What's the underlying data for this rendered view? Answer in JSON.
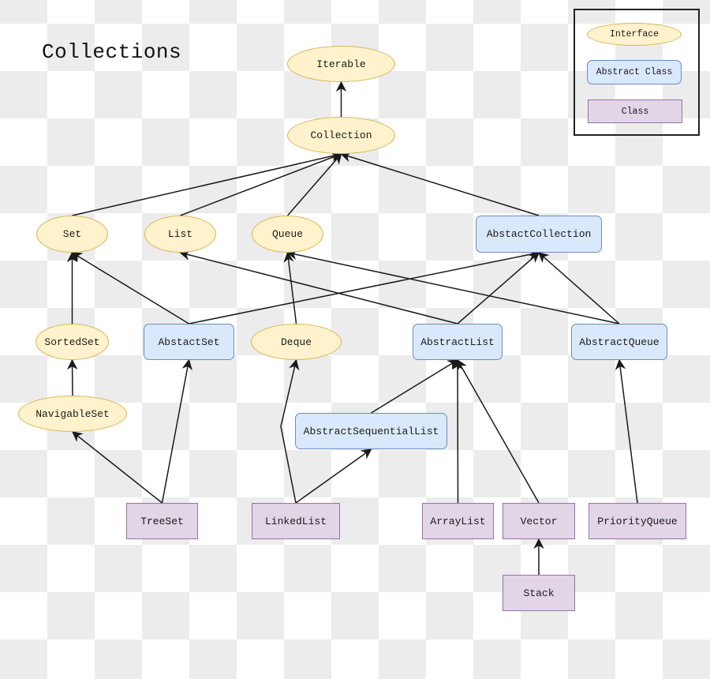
{
  "title": "Collections",
  "legend": {
    "interface": "Interface",
    "abstract_class": "Abstract Class",
    "class": "Class"
  },
  "colors": {
    "interface_fill": "#fff2cc",
    "interface_stroke": "#d6b656",
    "abstract_fill": "#dae8fc",
    "abstract_stroke": "#6c8ebf",
    "class_fill": "#e1d5e7",
    "class_stroke": "#9673a6",
    "edge": "#1a1a1a"
  },
  "nodes": {
    "iterable": {
      "label": "Iterable",
      "kind": "interface"
    },
    "collection": {
      "label": "Collection",
      "kind": "interface"
    },
    "set": {
      "label": "Set",
      "kind": "interface"
    },
    "list": {
      "label": "List",
      "kind": "interface"
    },
    "queue": {
      "label": "Queue",
      "kind": "interface"
    },
    "abstact_collection": {
      "label": "AbstactCollection",
      "kind": "abstract"
    },
    "sorted_set": {
      "label": "SortedSet",
      "kind": "interface"
    },
    "abstact_set": {
      "label": "AbstactSet",
      "kind": "abstract"
    },
    "deque": {
      "label": "Deque",
      "kind": "interface"
    },
    "abstract_list": {
      "label": "AbstractList",
      "kind": "abstract"
    },
    "abstract_queue": {
      "label": "AbstractQueue",
      "kind": "abstract"
    },
    "navigable_set": {
      "label": "NavigableSet",
      "kind": "interface"
    },
    "abstract_sequential_list": {
      "label": "AbstractSequentialList",
      "kind": "abstract"
    },
    "tree_set": {
      "label": "TreeSet",
      "kind": "class"
    },
    "linked_list": {
      "label": "LinkedList",
      "kind": "class"
    },
    "array_list": {
      "label": "ArrayList",
      "kind": "class"
    },
    "vector": {
      "label": "Vector",
      "kind": "class"
    },
    "priority_queue": {
      "label": "PriorityQueue",
      "kind": "class"
    },
    "stack": {
      "label": "Stack",
      "kind": "class"
    }
  },
  "edges": [
    {
      "from": "collection",
      "to": "iterable"
    },
    {
      "from": "set",
      "to": "collection"
    },
    {
      "from": "list",
      "to": "collection"
    },
    {
      "from": "queue",
      "to": "collection"
    },
    {
      "from": "abstact_collection",
      "to": "collection"
    },
    {
      "from": "sorted_set",
      "to": "set"
    },
    {
      "from": "abstact_set",
      "to": "set"
    },
    {
      "from": "abstact_set",
      "to": "abstact_collection"
    },
    {
      "from": "deque",
      "to": "queue"
    },
    {
      "from": "abstract_list",
      "to": "list"
    },
    {
      "from": "abstract_list",
      "to": "abstact_collection"
    },
    {
      "from": "abstract_queue",
      "to": "queue"
    },
    {
      "from": "abstract_queue",
      "to": "abstact_collection"
    },
    {
      "from": "navigable_set",
      "to": "sorted_set"
    },
    {
      "from": "abstract_sequential_list",
      "to": "abstract_list"
    },
    {
      "from": "tree_set",
      "to": "navigable_set"
    },
    {
      "from": "tree_set",
      "to": "abstact_set"
    },
    {
      "from": "linked_list",
      "to": "deque"
    },
    {
      "from": "linked_list",
      "to": "abstract_sequential_list"
    },
    {
      "from": "array_list",
      "to": "abstract_list"
    },
    {
      "from": "vector",
      "to": "abstract_list"
    },
    {
      "from": "priority_queue",
      "to": "abstract_queue"
    },
    {
      "from": "stack",
      "to": "vector"
    }
  ]
}
